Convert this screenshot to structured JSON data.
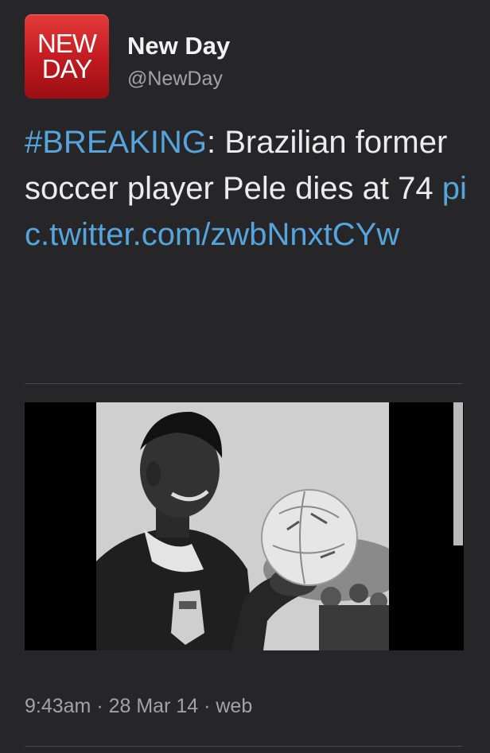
{
  "user": {
    "avatar_line1": "NEW",
    "avatar_line2": "DAY",
    "display_name": "New Day",
    "handle": "@NewDay"
  },
  "tweet": {
    "hashtag": "#BREAKING",
    "text": ": Brazilian former soccer player Pele dies at 74 ",
    "link": "pic.twitter.com/zwbNnxtCYw"
  },
  "footer": {
    "timestamp": "9:43am · 28 Mar 14 · web"
  },
  "colors": {
    "background": "#262628",
    "link": "#55a4dc",
    "avatar_red": "#c01a1f",
    "muted": "#a3a3a6"
  }
}
